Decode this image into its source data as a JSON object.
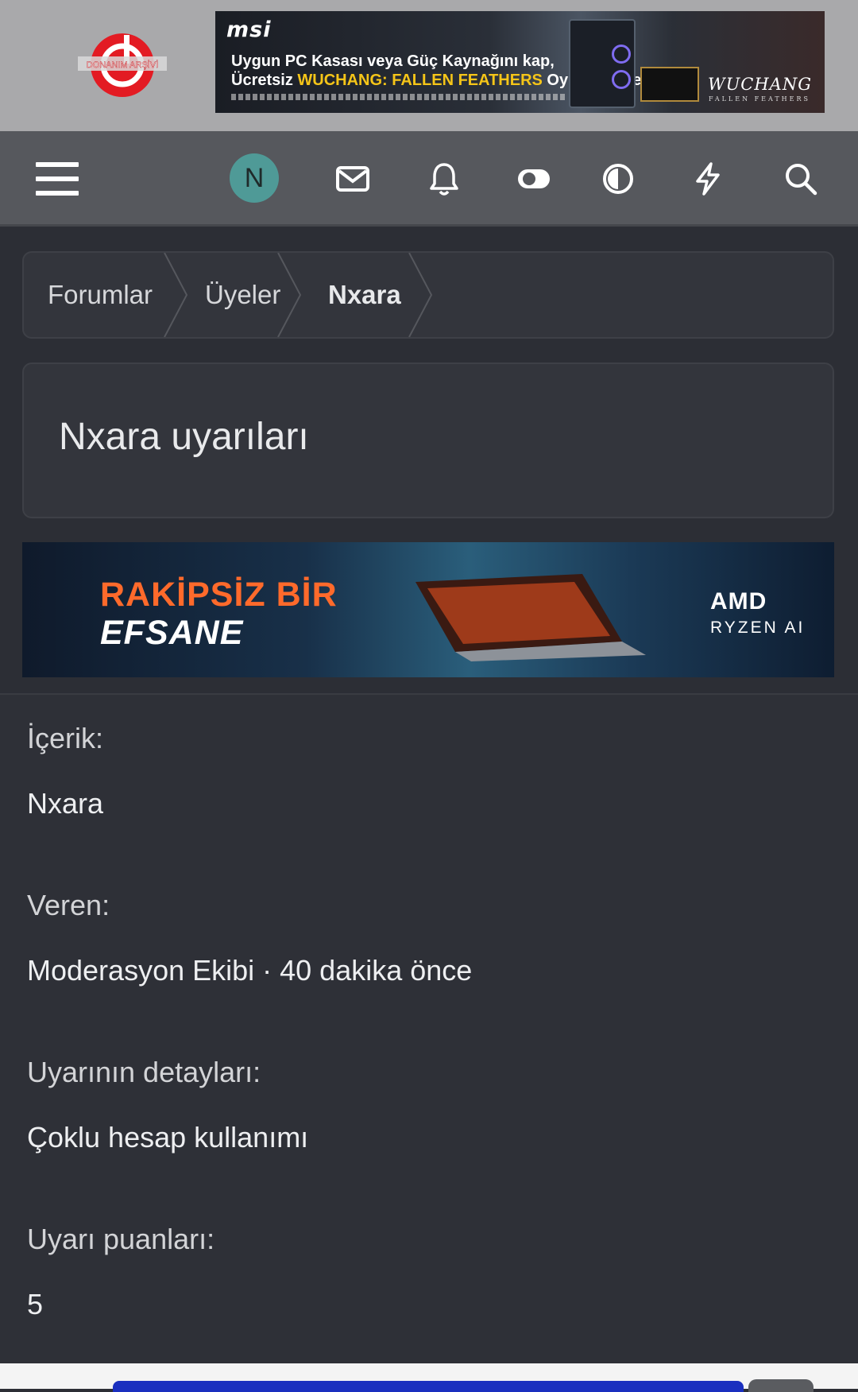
{
  "header": {
    "logo_text": "DONANIM ARŞİVİ",
    "ad_top": {
      "brand": "msi",
      "line1": "Uygun PC Kasası veya Güç Kaynağını kap,",
      "line2_prefix": "Ücretsiz ",
      "line2_highlight": "WUCHANG: FALLEN FEATHERS",
      "line2_suffix": " Oyununu Hemen Al!",
      "game_logo": "WUCHANG",
      "game_sub": "FALLEN FEATHERS"
    }
  },
  "navbar": {
    "avatar_letter": "N",
    "icons": [
      "menu-icon",
      "mail-icon",
      "bell-icon",
      "toggle-icon",
      "contrast-icon",
      "bolt-icon",
      "search-icon"
    ]
  },
  "breadcrumb": {
    "items": [
      "Forumlar",
      "Üyeler",
      "Nxara"
    ]
  },
  "page": {
    "title": "Nxara uyarıları"
  },
  "ad_mid": {
    "line1": "RAKİPSİZ BİR",
    "line2": "EFSANE",
    "brand": "AMD",
    "sub": "RYZEN AI"
  },
  "warning": {
    "content_label": "İçerik:",
    "content_value": "Nxara",
    "given_by_label": "Veren:",
    "given_by_value": "Moderasyon Ekibi · 40 dakika önce",
    "details_label": "Uyarının detayları:",
    "details_value": "Çoklu hesap kullanımı",
    "points_label": "Uyarı puanları:",
    "points_value": "5"
  },
  "colors": {
    "navbar": "#56585d",
    "background": "#2c2e35",
    "avatar": "#4f9a97",
    "ad_accent": "#ff6a2b"
  }
}
